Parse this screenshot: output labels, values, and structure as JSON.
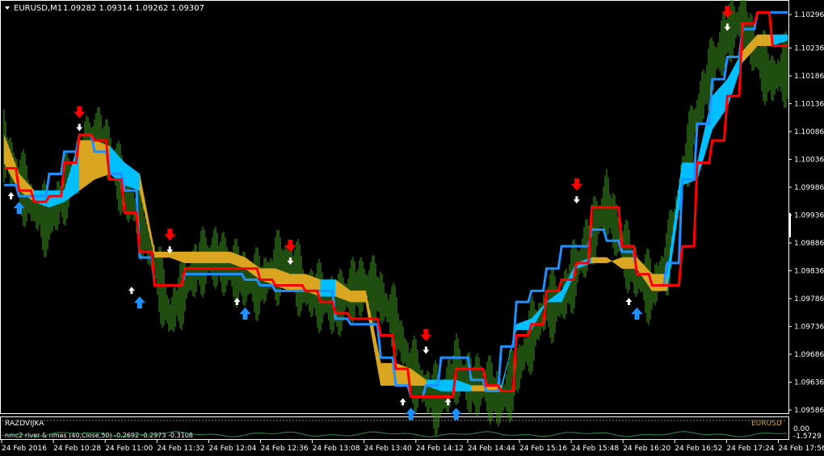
{
  "header": {
    "symbol": "EURUSD,M1",
    "ohlc": "1.09282 1.09314 1.09262 1.09307"
  },
  "subwindow": {
    "label": "RAZDVIJKA",
    "indicator_text": "nmc2 river  & nmas (40,Close,50) -0.2692 -0.2973 -0.3108",
    "corner_label": "EURUSD",
    "scale_labels": [
      "0.00",
      "-1.5729"
    ]
  },
  "colors": {
    "background": "#000000",
    "price_bars": "#3f9a1f",
    "river_gold": "#daa520",
    "river_cyan": "#00bfff",
    "line_red": "#ff0000",
    "line_blue": "#1e90ff",
    "arrow_up": "#1e90ff",
    "arrow_down": "#ff0000",
    "axis": "#ffffff"
  },
  "chart_data": {
    "type": "line",
    "title": "EURUSD,M1",
    "ylim": [
      1.09562,
      1.10296
    ],
    "price_ticks": [
      "1.10296",
      "1.10236",
      "1.10186",
      "1.10136",
      "1.10086",
      "1.10036",
      "1.09986",
      "1.09936",
      "1.09886",
      "1.09836",
      "1.09786",
      "1.09736",
      "1.09686",
      "1.09636",
      "1.09586"
    ],
    "time_ticks": [
      "24 Feb 2016",
      "24 Feb 10:28",
      "24 Feb 11:00",
      "24 Feb 11:32",
      "24 Feb 12:04",
      "24 Feb 12:36",
      "24 Feb 13:08",
      "24 Feb 13:40",
      "24 Feb 14:12",
      "24 Feb 14:44",
      "24 Feb 15:16",
      "24 Feb 15:48",
      "24 Feb 16:20",
      "24 Feb 16:52",
      "24 Feb 17:24",
      "24 Feb 17:56"
    ],
    "series": [
      {
        "name": "Close",
        "values": [
          1.1006,
          1.1,
          1.0995,
          1.0992,
          1.0998,
          1.1003,
          1.1008,
          1.1005,
          1.0998,
          1.0993,
          1.0985,
          1.0975,
          1.0981,
          1.0985,
          1.0986,
          1.0984,
          1.0982,
          1.0981,
          1.0984,
          1.0985,
          1.098,
          1.0979,
          1.0977,
          1.098,
          1.0981,
          1.0979,
          1.0974,
          1.0966,
          1.0962,
          1.096,
          1.0966,
          1.0963,
          1.0963,
          1.096,
          1.0965,
          1.0972,
          1.0977,
          1.0978,
          1.0984,
          1.099,
          1.0996,
          1.0988,
          1.0983,
          1.098,
          1.0985,
          1.1,
          1.1012,
          1.102,
          1.1026,
          1.1029,
          1.1022,
          1.1018,
          1.102
        ]
      },
      {
        "name": "River upper",
        "values": [
          1.1008,
          1.1001,
          1.0998,
          1.0998,
          1.0998,
          1.1007,
          1.1007,
          1.1006,
          1.1003,
          1.1001,
          1.0987,
          1.0987,
          1.0987,
          1.0987,
          1.0987,
          1.0987,
          1.0986,
          1.0984,
          1.0984,
          1.0983,
          1.0983,
          1.0982,
          1.0982,
          1.098,
          1.098,
          1.0967,
          1.0967,
          1.0966,
          1.0964,
          1.0964,
          1.0964,
          1.0963,
          1.0963,
          1.0963,
          1.0973,
          1.0973,
          1.0978,
          1.0978,
          1.0984,
          1.0985,
          1.0985,
          1.0986,
          1.0986,
          1.0983,
          1.0983,
          1.1003,
          1.1003,
          1.1015,
          1.1018,
          1.1023,
          1.1026,
          1.1026,
          1.1026
        ]
      },
      {
        "name": "River lower",
        "values": [
          1.1003,
          1.0998,
          1.0996,
          1.0995,
          1.0996,
          1.0998,
          1.1,
          1.1001,
          1.0999,
          1.0998,
          1.0986,
          1.0986,
          1.0985,
          1.0985,
          1.0985,
          1.0985,
          1.0984,
          1.0982,
          1.0981,
          1.098,
          1.098,
          1.0979,
          1.0979,
          1.0978,
          1.0978,
          1.0963,
          1.0963,
          1.0963,
          1.0963,
          1.0962,
          1.0962,
          1.0962,
          1.0962,
          1.0962,
          1.0974,
          1.0975,
          1.0978,
          1.098,
          1.0985,
          1.0986,
          1.0986,
          1.0984,
          1.0984,
          1.098,
          1.098,
          1.0999,
          1.1,
          1.1009,
          1.1013,
          1.1021,
          1.1024,
          1.1024,
          1.1025
        ]
      },
      {
        "name": "Red line",
        "values": [
          1.1002,
          1.0998,
          1.0996,
          1.0997,
          1.1003,
          1.1008,
          1.1007,
          1.1,
          1.0994,
          1.0987,
          1.0981,
          1.0981,
          1.0984,
          1.0984,
          1.0984,
          1.0984,
          1.0984,
          1.0982,
          1.0981,
          1.0981,
          1.098,
          1.0978,
          1.0976,
          1.0975,
          1.0975,
          1.0972,
          1.0966,
          1.0961,
          1.0961,
          1.0961,
          1.0966,
          1.0966,
          1.0963,
          1.0962,
          1.0972,
          1.0974,
          1.098,
          1.0982,
          1.0985,
          1.0995,
          1.0995,
          1.0988,
          1.0983,
          1.0981,
          1.0981,
          1.0988,
          1.1003,
          1.1007,
          1.1015,
          1.1028,
          1.103,
          1.1024,
          1.1024
        ]
      },
      {
        "name": "Blue line",
        "values": [
          1.0999,
          1.0997,
          1.0997,
          1.1001,
          1.1005,
          1.1008,
          1.1005,
          1.1001,
          1.0998,
          1.0986,
          1.0981,
          1.0981,
          1.0983,
          1.0983,
          1.0983,
          1.0983,
          1.0982,
          1.0981,
          1.098,
          1.098,
          1.098,
          1.098,
          1.0975,
          1.0974,
          1.0974,
          1.0968,
          1.0963,
          1.0961,
          1.0963,
          1.0968,
          1.0968,
          1.0964,
          1.0962,
          1.097,
          1.0978,
          1.098,
          1.0984,
          1.0988,
          1.0988,
          1.0991,
          1.0989,
          1.0987,
          1.0983,
          1.0981,
          1.0985,
          1.1,
          1.101,
          1.1018,
          1.1022,
          1.1027,
          1.103,
          1.103,
          1.103
        ]
      }
    ],
    "signals": [
      {
        "type": "buy",
        "bar": 1,
        "price": 1.0996
      },
      {
        "type": "sell",
        "bar": 5,
        "price": 1.1011
      },
      {
        "type": "buy",
        "bar": 9,
        "price": 1.0979
      },
      {
        "type": "sell",
        "bar": 11,
        "price": 1.0989
      },
      {
        "type": "buy",
        "bar": 16,
        "price": 1.0977
      },
      {
        "type": "sell",
        "bar": 19,
        "price": 1.0987
      },
      {
        "type": "buy",
        "bar": 27,
        "price": 1.0959
      },
      {
        "type": "sell",
        "bar": 28,
        "price": 1.0971
      },
      {
        "type": "buy",
        "bar": 30,
        "price": 1.0959
      },
      {
        "type": "sell",
        "bar": 38,
        "price": 1.0998
      },
      {
        "type": "buy",
        "bar": 42,
        "price": 1.0977
      },
      {
        "type": "sell",
        "bar": 48,
        "price": 1.1029
      }
    ]
  }
}
